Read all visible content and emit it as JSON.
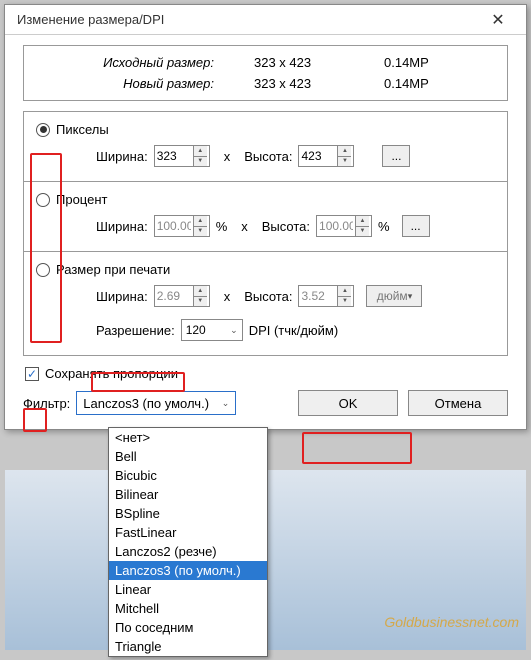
{
  "window": {
    "title": "Изменение размера/DPI"
  },
  "info": {
    "src_label": "Исходный размер:",
    "new_label": "Новый размер:",
    "src_dim": "323 x 423",
    "new_dim": "323 x 423",
    "src_mp": "0.14MP",
    "new_mp": "0.14MP"
  },
  "pixels": {
    "radio_label": "Пикселы",
    "width_label": "Ширина:",
    "height_label": "Высота:",
    "width": "323",
    "height": "423",
    "x": "x"
  },
  "percent": {
    "radio_label": "Процент",
    "width_label": "Ширина:",
    "height_label": "Высота:",
    "width": "100.00",
    "height": "100.00",
    "pct": "%"
  },
  "print": {
    "radio_label": "Размер при печати",
    "width_label": "Ширина:",
    "height_label": "Высота:",
    "width": "2.69",
    "height": "3.52",
    "x": "x",
    "unit": "дюйм",
    "res_label": "Разрешение:",
    "res_value": "120",
    "dpi_label": "DPI (тчк/дюйм)"
  },
  "keep_aspect": {
    "label": "Сохранять пропорции"
  },
  "filter": {
    "label": "Фильтр:",
    "selected": "Lanczos3 (по умолч.)",
    "options": [
      "<нет>",
      "Bell",
      "Bicubic",
      "Bilinear",
      "BSpline",
      "FastLinear",
      "Lanczos2 (резче)",
      "Lanczos3 (по умолч.)",
      "Linear",
      "Mitchell",
      "По соседним",
      "Triangle"
    ]
  },
  "buttons": {
    "ok": "OK",
    "cancel": "Отмена"
  },
  "dots": "...",
  "watermark": "Goldbusinessnet.com"
}
